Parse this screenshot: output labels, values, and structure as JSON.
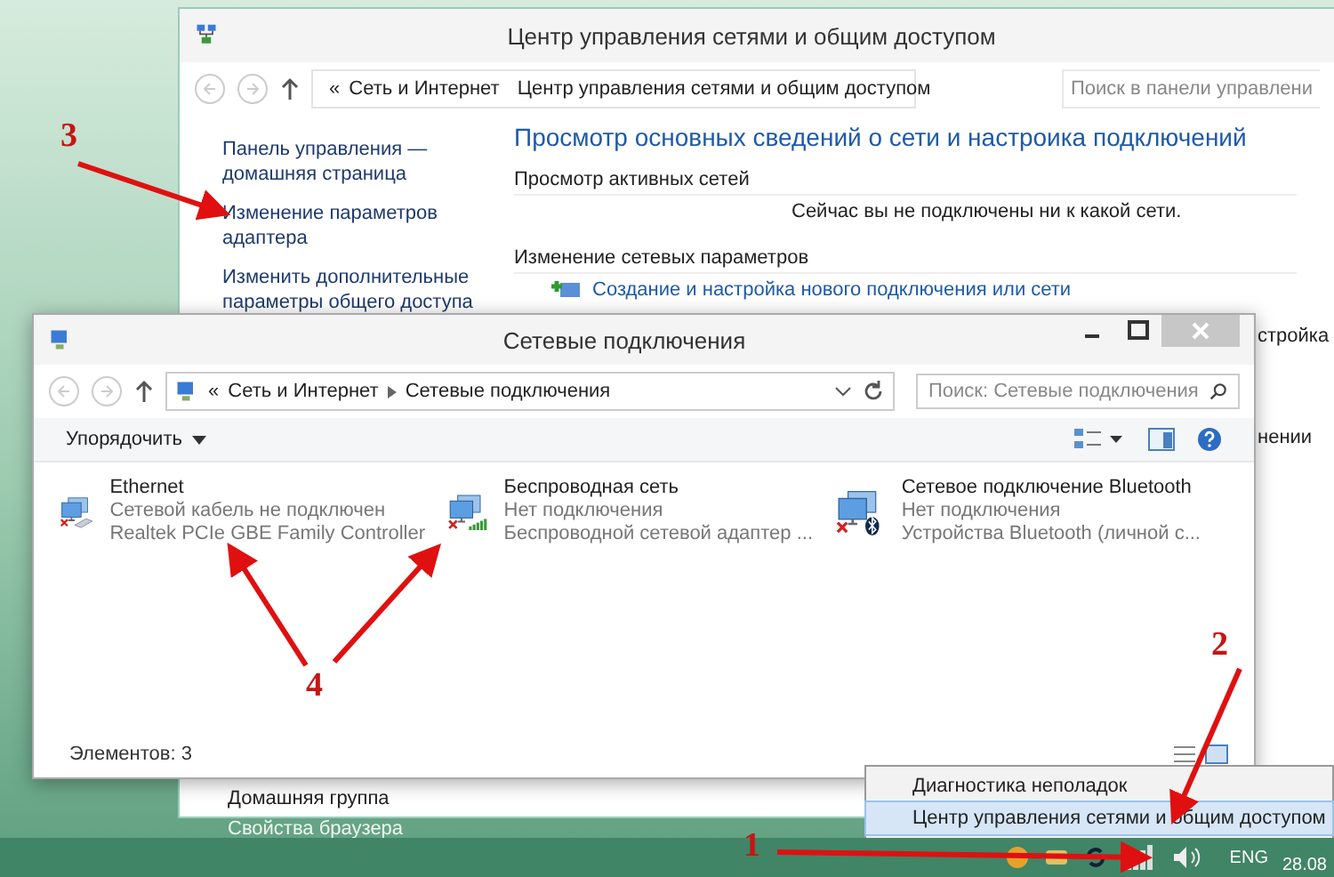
{
  "back_window": {
    "title": "Центр управления сетями и общим доступом",
    "breadcrumb": {
      "prefix": "«",
      "parts": [
        "Сеть и Интернет",
        "Центр управления сетями и общим доступом"
      ]
    },
    "search": {
      "placeholder": "Поиск в панели управлени"
    },
    "sidebar": {
      "items": [
        "Панель управления — домашняя страница",
        "Изменение параметров адаптера",
        "Изменить дополнительные параметры общего доступа"
      ],
      "bottom_items": [
        "Домашняя группа",
        "Свойства браузера"
      ]
    },
    "heading": "Просмотр основных сведений о сети и настроика подключений",
    "sections": [
      {
        "title": "Просмотр активных сетей",
        "text": "Сейчас вы не подключены ни к какой сети."
      },
      {
        "title": "Изменение сетевых параметров"
      }
    ],
    "link": "Создание и настройка нового подключения или сети",
    "cut_texts": [
      "стройка",
      "нении"
    ]
  },
  "front_window": {
    "title": "Сетевые подключения",
    "breadcrumb": {
      "prefix": "«",
      "parts": [
        "Сеть и Интернет",
        "Сетевые подключения"
      ]
    },
    "search": {
      "placeholder": "Поиск: Сетевые подключения"
    },
    "toolbar": {
      "organize": "Упорядочить"
    },
    "connections": [
      {
        "kind": "ethernet",
        "name": "Ethernet",
        "status": "Сетевой кабель не подключен",
        "adapter": "Realtek PCIe GBE Family Controller"
      },
      {
        "kind": "wifi",
        "name": "Беспроводная сеть",
        "status": "Нет подключения",
        "adapter": "Беспроводной сетевой адаптер ..."
      },
      {
        "kind": "bluetooth",
        "name": "Сетевое подключение Bluetooth",
        "status": "Нет подключения",
        "adapter": "Устройства Bluetooth (личной с..."
      }
    ],
    "status_bar": "Элементов: 3"
  },
  "context_menu": {
    "items": [
      {
        "label": "Диагностика неполадок",
        "selected": false
      },
      {
        "label": "Центр управления сетями и общим доступом",
        "selected": true
      }
    ]
  },
  "taskbar": {
    "language": "ENG",
    "date": "28.08"
  },
  "annotations": [
    {
      "label": "3"
    },
    {
      "label": "4"
    },
    {
      "label": "2"
    },
    {
      "label": "1"
    }
  ]
}
